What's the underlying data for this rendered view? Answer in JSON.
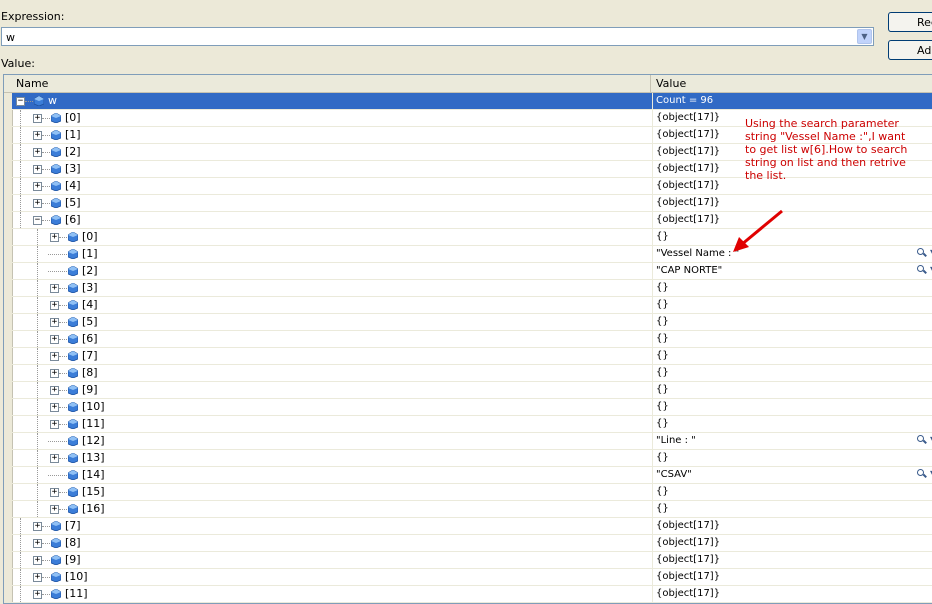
{
  "expression": {
    "label": "Expression:",
    "value": "w"
  },
  "value_label": "Value:",
  "buttons": {
    "reevaluate": "Reevaluate",
    "add_watch": "Add Watch"
  },
  "columns": {
    "name": "Name",
    "value": "Value"
  },
  "annotation": "Using the search parameter\nstring \"Vessel Name :\",I want\nto get list w[6].How to search\nstring on list and then retrive\nthe list.",
  "colors": {
    "selection": "#316ac5",
    "annotation": "#cc0000"
  },
  "rows": [
    {
      "name": "w",
      "value": "Count = 96",
      "level": 0,
      "expander": "minus",
      "selected": true
    },
    {
      "name": "[0]",
      "value": "{object[17]}",
      "level": 1,
      "expander": "plus"
    },
    {
      "name": "[1]",
      "value": "{object[17]}",
      "level": 1,
      "expander": "plus"
    },
    {
      "name": "[2]",
      "value": "{object[17]}",
      "level": 1,
      "expander": "plus"
    },
    {
      "name": "[3]",
      "value": "{object[17]}",
      "level": 1,
      "expander": "plus"
    },
    {
      "name": "[4]",
      "value": "{object[17]}",
      "level": 1,
      "expander": "plus"
    },
    {
      "name": "[5]",
      "value": "{object[17]}",
      "level": 1,
      "expander": "plus"
    },
    {
      "name": "[6]",
      "value": "{object[17]}",
      "level": 1,
      "expander": "minus"
    },
    {
      "name": "[0]",
      "value": "{}",
      "level": 2,
      "expander": "plus"
    },
    {
      "name": "[1]",
      "value": "\"Vessel Name : \"",
      "level": 2,
      "expander": "none",
      "magnifier": true
    },
    {
      "name": "[2]",
      "value": "\"CAP NORTE\"",
      "level": 2,
      "expander": "none",
      "magnifier": true
    },
    {
      "name": "[3]",
      "value": "{}",
      "level": 2,
      "expander": "plus"
    },
    {
      "name": "[4]",
      "value": "{}",
      "level": 2,
      "expander": "plus"
    },
    {
      "name": "[5]",
      "value": "{}",
      "level": 2,
      "expander": "plus"
    },
    {
      "name": "[6]",
      "value": "{}",
      "level": 2,
      "expander": "plus"
    },
    {
      "name": "[7]",
      "value": "{}",
      "level": 2,
      "expander": "plus"
    },
    {
      "name": "[8]",
      "value": "{}",
      "level": 2,
      "expander": "plus"
    },
    {
      "name": "[9]",
      "value": "{}",
      "level": 2,
      "expander": "plus"
    },
    {
      "name": "[10]",
      "value": "{}",
      "level": 2,
      "expander": "plus"
    },
    {
      "name": "[11]",
      "value": "{}",
      "level": 2,
      "expander": "plus"
    },
    {
      "name": "[12]",
      "value": "\"Line : \"",
      "level": 2,
      "expander": "none",
      "magnifier": true
    },
    {
      "name": "[13]",
      "value": "{}",
      "level": 2,
      "expander": "plus"
    },
    {
      "name": "[14]",
      "value": "\"CSAV\"",
      "level": 2,
      "expander": "none",
      "magnifier": true
    },
    {
      "name": "[15]",
      "value": "{}",
      "level": 2,
      "expander": "plus"
    },
    {
      "name": "[16]",
      "value": "{}",
      "level": 2,
      "expander": "plus"
    },
    {
      "name": "[7]",
      "value": "{object[17]}",
      "level": 1,
      "expander": "plus"
    },
    {
      "name": "[8]",
      "value": "{object[17]}",
      "level": 1,
      "expander": "plus"
    },
    {
      "name": "[9]",
      "value": "{object[17]}",
      "level": 1,
      "expander": "plus"
    },
    {
      "name": "[10]",
      "value": "{object[17]}",
      "level": 1,
      "expander": "plus"
    },
    {
      "name": "[11]",
      "value": "{object[17]}",
      "level": 1,
      "expander": "plus"
    }
  ]
}
